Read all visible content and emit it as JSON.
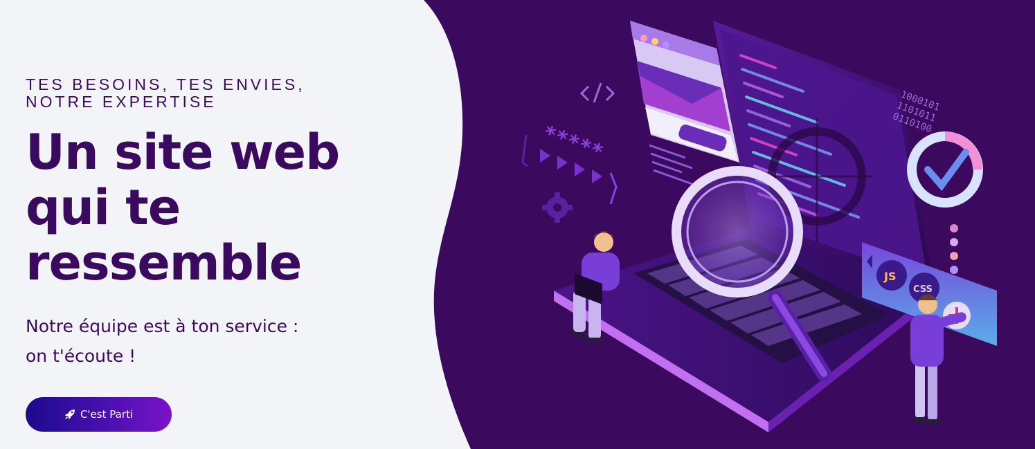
{
  "hero": {
    "kicker": "TES BESOINS, TES ENVIES, NOTRE EXPERTISE",
    "title_lines": [
      "Un site web",
      "qui te",
      "ressemble"
    ],
    "subtitle_lines": [
      "Notre équipe est à ton service :",
      "on t'écoute !"
    ],
    "cta_label": "C'est Parti",
    "cta_icon": "rocket-icon"
  },
  "illustration": {
    "code_tag": "</>",
    "password_mask": "*****",
    "badge_js": "JS",
    "badge_css": "CSS",
    "binary_text": "1000101\n1101011\n0110100",
    "colors": {
      "background": "#3b0a5e",
      "accent": "#8b2fe0",
      "text_dark": "#3a0a5f"
    }
  }
}
